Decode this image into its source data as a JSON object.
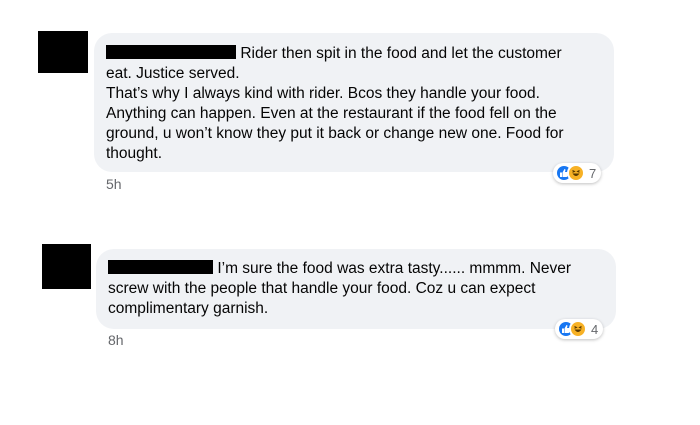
{
  "comments": [
    {
      "lines": [
        "Rider then spit in the food and let the customer",
        "eat. Justice served.",
        "That’s why I always kind with rider. Bcos they handle your food.",
        "Anything can happen. Even at the restaurant if the food fell on the",
        "ground, u won’t know they put it back or change new one. Food for",
        "thought."
      ],
      "timestamp": "5h",
      "reaction_count": "7",
      "reactions": [
        "like-icon",
        "haha-icon"
      ]
    },
    {
      "lines": [
        "I’m sure the food was extra tasty...... mmmm. Never",
        "screw with the people that handle your food. Coz u can expect",
        "complimentary garnish."
      ],
      "timestamp": "8h",
      "reaction_count": "4",
      "reactions": [
        "like-icon",
        "haha-icon"
      ]
    }
  ],
  "colors": {
    "bubble": "#f0f2f5",
    "like": "#1877f2",
    "haha": "#f7b125",
    "muted_text": "#65676b"
  }
}
